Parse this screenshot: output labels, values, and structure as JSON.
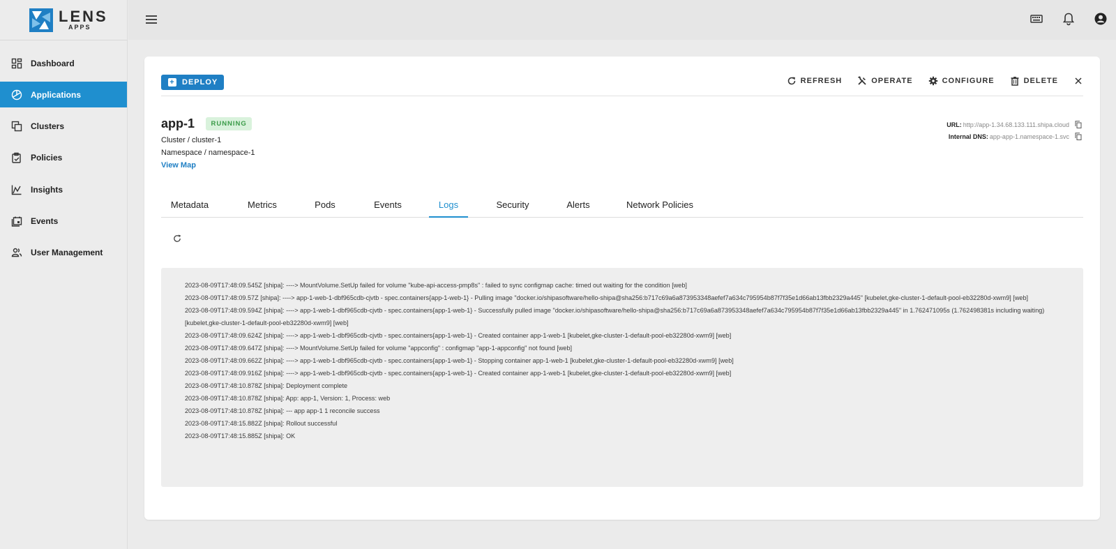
{
  "logo": {
    "main": "LENS",
    "sub": "APPS"
  },
  "sidebar": {
    "items": [
      {
        "label": "Dashboard",
        "icon": "dashboard-icon"
      },
      {
        "label": "Applications",
        "icon": "applications-icon",
        "active": true
      },
      {
        "label": "Clusters",
        "icon": "clusters-icon"
      },
      {
        "label": "Policies",
        "icon": "policies-icon"
      },
      {
        "label": "Insights",
        "icon": "insights-icon"
      },
      {
        "label": "Events",
        "icon": "events-icon"
      },
      {
        "label": "User Management",
        "icon": "user-management-icon"
      }
    ]
  },
  "topbar": {
    "icons": [
      "keyboard-icon",
      "bell-icon",
      "account-icon"
    ]
  },
  "toolbar": {
    "deploy_label": "DEPLOY",
    "refresh_label": "REFRESH",
    "operate_label": "OPERATE",
    "configure_label": "CONFIGURE",
    "delete_label": "DELETE"
  },
  "app": {
    "name": "app-1",
    "status": "RUNNING",
    "cluster": "Cluster / cluster-1",
    "namespace": "Namespace / namespace-1",
    "view_map": "View Map",
    "url_label": "URL:",
    "url_value": "http://app-1.34.68.133.111.shipa.cloud",
    "dns_label": "Internal DNS:",
    "dns_value": "app-app-1.namespace-1.svc"
  },
  "tabs": [
    "Metadata",
    "Metrics",
    "Pods",
    "Events",
    "Logs",
    "Security",
    "Alerts",
    "Network Policies"
  ],
  "active_tab": "Logs",
  "colors": {
    "accent": "#1f8fcf",
    "status_running_bg": "#d9f2dc",
    "status_running_fg": "#3a9b48"
  },
  "logs": [
    "2023-08-09T17:48:09.545Z [shipa]: ----> MountVolume.SetUp failed for volume \"kube-api-access-pmp8s\" : failed to sync configmap cache: timed out waiting for the condition [web]",
    "2023-08-09T17:48:09.57Z [shipa]: ----> app-1-web-1-dbf965cdb-cjvtb - spec.containers{app-1-web-1} - Pulling image \"docker.io/shipasoftware/hello-shipa@sha256:b717c69a6a873953348aefef7a634c795954b87f7f35e1d66ab13fbb2329a445\" [kubelet,gke-cluster-1-default-pool-eb32280d-xwm9] [web]",
    "2023-08-09T17:48:09.594Z [shipa]: ----> app-1-web-1-dbf965cdb-cjvtb - spec.containers{app-1-web-1} - Successfully pulled image \"docker.io/shipasoftware/hello-shipa@sha256:b717c69a6a873953348aefef7a634c795954b87f7f35e1d66ab13fbb2329a445\" in 1.762471095s (1.762498381s including waiting) [kubelet,gke-cluster-1-default-pool-eb32280d-xwm9] [web]",
    "2023-08-09T17:48:09.624Z [shipa]: ----> app-1-web-1-dbf965cdb-cjvtb - spec.containers{app-1-web-1} - Created container app-1-web-1 [kubelet,gke-cluster-1-default-pool-eb32280d-xwm9] [web]",
    "2023-08-09T17:48:09.647Z [shipa]: ----> MountVolume.SetUp failed for volume \"appconfig\" : configmap \"app-1-appconfig\" not found [web]",
    "2023-08-09T17:48:09.662Z [shipa]: ----> app-1-web-1-dbf965cdb-cjvtb - spec.containers{app-1-web-1} - Stopping container app-1-web-1 [kubelet,gke-cluster-1-default-pool-eb32280d-xwm9] [web]",
    "2023-08-09T17:48:09.916Z [shipa]: ----> app-1-web-1-dbf965cdb-cjvtb - spec.containers{app-1-web-1} - Created container app-1-web-1 [kubelet,gke-cluster-1-default-pool-eb32280d-xwm9] [web]",
    "2023-08-09T17:48:10.878Z [shipa]: Deployment complete",
    "2023-08-09T17:48:10.878Z [shipa]: App: app-1, Version: 1, Process: web",
    "2023-08-09T17:48:10.878Z [shipa]: --- app app-1 1 reconcile success",
    "2023-08-09T17:48:15.882Z [shipa]: Rollout successful",
    "2023-08-09T17:48:15.885Z [shipa]: OK"
  ]
}
